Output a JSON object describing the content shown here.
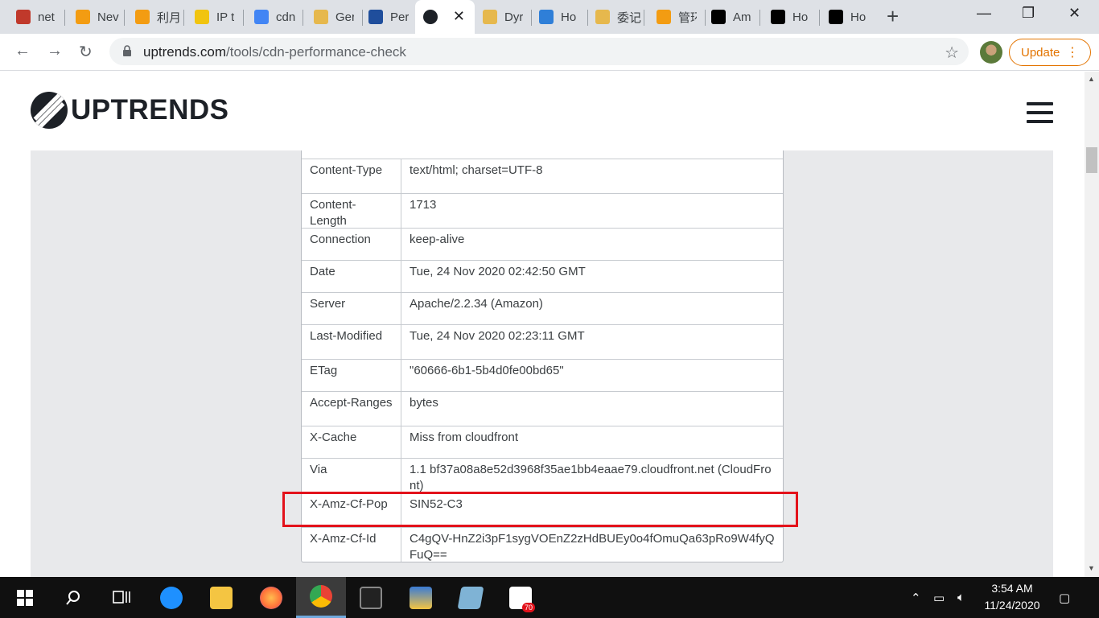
{
  "browser": {
    "tabs": [
      {
        "label": "net",
        "icon": "bars-icon",
        "color": "#c0392b"
      },
      {
        "label": "Nev",
        "icon": "box-icon",
        "color": "#f39c12"
      },
      {
        "label": "利月",
        "icon": "box-icon",
        "color": "#f39c12"
      },
      {
        "label": "IP t",
        "icon": "v-icon",
        "color": "#f1c40f"
      },
      {
        "label": "cdn",
        "icon": "google-icon",
        "color": "#4285f4"
      },
      {
        "label": "Ger",
        "icon": "cube-icon",
        "color": "#e6b84d"
      },
      {
        "label": "Per",
        "icon": "speed-icon",
        "color": "#1f4e9c"
      },
      {
        "label": "",
        "icon": "uptrends-icon",
        "color": "#1d2127"
      },
      {
        "label": "Dyr",
        "icon": "cube-icon",
        "color": "#e6b84d"
      },
      {
        "label": "Ho",
        "icon": "diamond-icon",
        "color": "#2f7fd8"
      },
      {
        "label": "委记",
        "icon": "cube-icon",
        "color": "#e6b84d"
      },
      {
        "label": "管环",
        "icon": "box-icon",
        "color": "#f39c12"
      },
      {
        "label": "Am",
        "icon": "medium-icon",
        "color": "#000000"
      },
      {
        "label": "Ho",
        "icon": "medium-icon",
        "color": "#000000"
      },
      {
        "label": "Ho",
        "icon": "medium-icon",
        "color": "#000000"
      }
    ],
    "active_tab_close": "✕",
    "new_tab": "+",
    "url_domain": "uptrends.com",
    "url_path": "/tools/cdn-performance-check",
    "update_label": "Update"
  },
  "site": {
    "logo_text": "UPTRENDS"
  },
  "headers_table": {
    "rows": [
      {
        "key": "Content-Type",
        "value": "text/html; charset=UTF-8"
      },
      {
        "key": "Content-Length",
        "value": "1713"
      },
      {
        "key": "Connection",
        "value": "keep-alive"
      },
      {
        "key": "Date",
        "value": "Tue, 24 Nov 2020 02:42:50 GMT"
      },
      {
        "key": "Server",
        "value": "Apache/2.2.34 (Amazon)"
      },
      {
        "key": "Last-Modified",
        "value": "Tue, 24 Nov 2020 02:23:11 GMT"
      },
      {
        "key": "ETag",
        "value": "\"60666-6b1-5b4d0fe00bd65\""
      },
      {
        "key": "Accept-Ranges",
        "value": "bytes"
      },
      {
        "key": "X-Cache",
        "value": "Miss from cloudfront"
      },
      {
        "key": "Via",
        "value": "1.1 bf37a08a8e52d3968f35ae1bb4eaae79.cloudfront.net (CloudFront)"
      },
      {
        "key": "X-Amz-Cf-Pop",
        "value": "SIN52-C3"
      },
      {
        "key": "X-Amz-Cf-Id",
        "value": "C4gQV-HnZ2i3pF1sygVOEnZ2zHdBUEy0o4fOmuQa63pRo9W4fyQFuQ=="
      }
    ],
    "highlight_color": "#e3121b"
  },
  "taskbar": {
    "apps": [
      {
        "name": "start",
        "color": "#ffffff"
      },
      {
        "name": "search",
        "color": "#ffffff"
      },
      {
        "name": "task-view",
        "color": "#ffffff"
      },
      {
        "name": "internet-explorer",
        "color": "#1e90ff"
      },
      {
        "name": "file-explorer",
        "color": "#f4c542"
      },
      {
        "name": "firefox",
        "color": "#ff7139"
      },
      {
        "name": "chrome",
        "color": "#34a853"
      },
      {
        "name": "terminal",
        "color": "#333333"
      },
      {
        "name": "network",
        "color": "#3a7bd5"
      },
      {
        "name": "notes",
        "color": "#7fb3d5"
      },
      {
        "name": "app-badge",
        "color": "#1abc9c"
      }
    ],
    "badge_count": "70",
    "time": "3:54 AM",
    "date": "11/24/2020"
  }
}
